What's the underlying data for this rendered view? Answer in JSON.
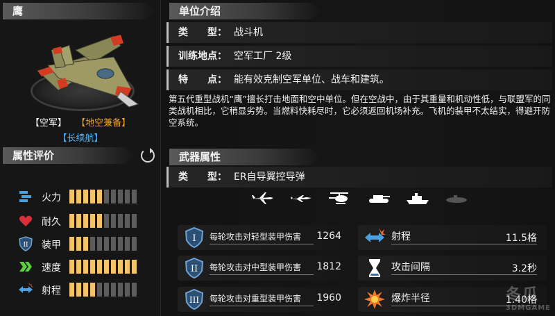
{
  "unit_name": "鹰",
  "tags": {
    "air": "【空军】",
    "both": "【地空兼备】",
    "long": "【长续航】"
  },
  "attr_title": "属性评价",
  "attributes": [
    {
      "label": "火力",
      "value": 5,
      "max": 10,
      "icon": "missile-icon"
    },
    {
      "label": "耐久",
      "value": 5,
      "max": 10,
      "icon": "heart-icon"
    },
    {
      "label": "装甲",
      "value": 3,
      "max": 10,
      "icon": "armor-icon"
    },
    {
      "label": "速度",
      "value": 10,
      "max": 10,
      "icon": "speed-chevron-icon"
    },
    {
      "label": "射程",
      "value": 4,
      "max": 10,
      "icon": "range-arrow-icon"
    }
  ],
  "intro_title": "单位介绍",
  "info": [
    {
      "key": "类　　型：",
      "value": "战斗机"
    },
    {
      "key": "训练地点：",
      "value": "空军工厂 2级"
    },
    {
      "key": "特　　点：",
      "value": "能有效克制空军单位、战车和建筑。"
    }
  ],
  "description": "第五代重型战机“鹰”擅长打击地面和空中单位。但在空战中，由于其重量和机动性低，与联盟军的同类战机相比，它稍显劣势。当燃料快耗尽时，它必须返回机场补充。飞机的装甲不太结实，得避开防空系统。",
  "weapon_title": "武器属性",
  "weapon_type": {
    "key": "类　　型：",
    "value": "ER自导翼控导弹"
  },
  "target_icons": [
    "plane-icon",
    "jet-icon",
    "helicopter-icon",
    "tank-icon",
    "ship-icon",
    "submarine-icon"
  ],
  "damage": [
    {
      "label": "每轮攻击对轻型装甲伤害",
      "value": "1264",
      "icon": "armor-1-icon"
    },
    {
      "label": "每轮攻击对中型装甲伤害",
      "value": "1812",
      "icon": "armor-2-icon"
    },
    {
      "label": "每轮攻击对重型装甲伤害",
      "value": "1960",
      "icon": "armor-3-icon"
    }
  ],
  "weapon_stats": [
    {
      "label": "射程",
      "value": "11.5格",
      "icon": "range-icon"
    },
    {
      "label": "攻击间隔",
      "value": "3.2秒",
      "icon": "hourglass-icon"
    },
    {
      "label": "爆炸半径",
      "value": "1.40格",
      "icon": "explosion-icon"
    }
  ],
  "watermark": {
    "main": "冬瓜",
    "sub": "3DMGAME"
  }
}
